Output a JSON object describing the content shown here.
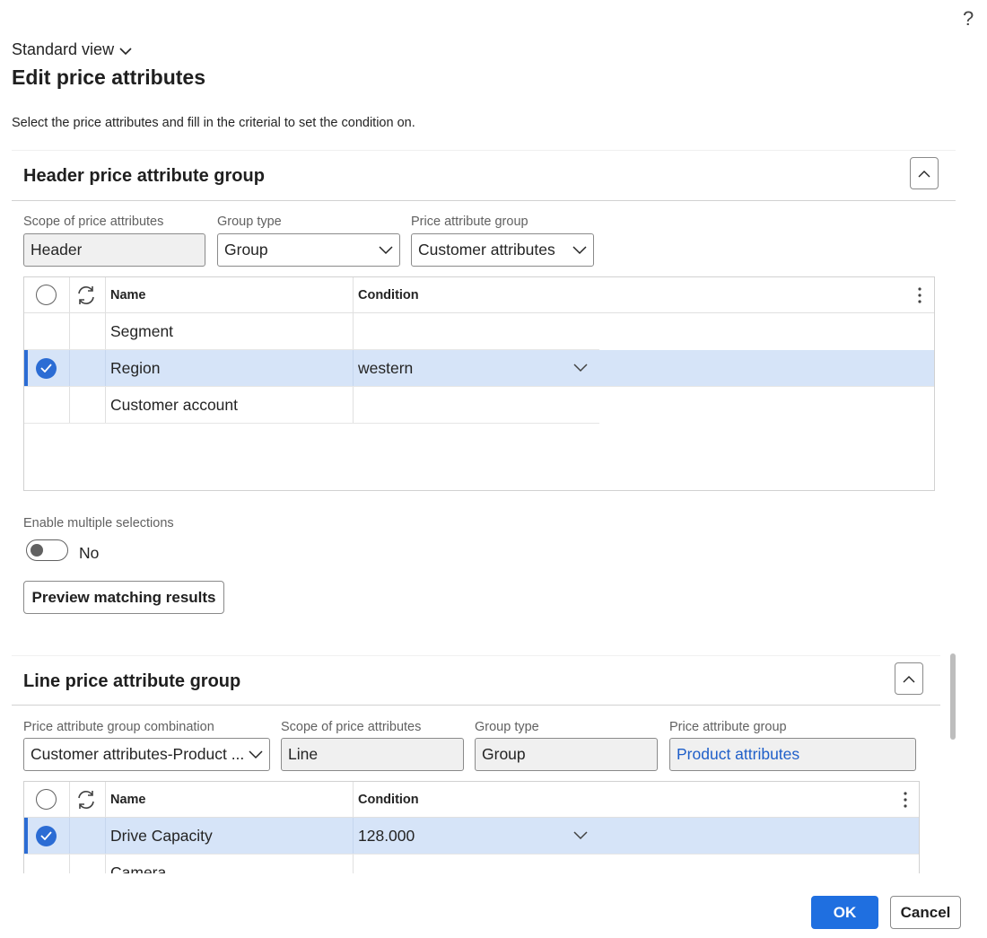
{
  "help": {
    "icon": "question-mark-icon",
    "label": "?"
  },
  "view_selector": {
    "label": "Standard view"
  },
  "page": {
    "title": "Edit price attributes",
    "description": "Select the price attributes and fill in the criterial to set the condition on."
  },
  "header_section": {
    "title": "Header price attribute group",
    "fields": {
      "scope": {
        "label": "Scope of price attributes",
        "value": "Header"
      },
      "group_type": {
        "label": "Group type",
        "value": "Group"
      },
      "price_group": {
        "label": "Price attribute group",
        "value": "Customer attributes"
      }
    },
    "grid": {
      "col_name": "Name",
      "col_condition": "Condition",
      "rows": [
        {
          "name": "Segment",
          "condition": "",
          "selected": false
        },
        {
          "name": "Region",
          "condition": "western",
          "selected": true
        },
        {
          "name": "Customer account",
          "condition": "",
          "selected": false
        }
      ]
    },
    "multi_select": {
      "label": "Enable multiple selections",
      "value": "No"
    },
    "preview_button": "Preview matching results"
  },
  "line_section": {
    "title": "Line price attribute group",
    "fields": {
      "combination": {
        "label": "Price attribute group combination",
        "value": "Customer attributes-Product ..."
      },
      "scope": {
        "label": "Scope of price attributes",
        "value": "Line"
      },
      "group_type": {
        "label": "Group type",
        "value": "Group"
      },
      "price_group": {
        "label": "Price attribute group",
        "value": "Product attributes"
      }
    },
    "grid": {
      "col_name": "Name",
      "col_condition": "Condition",
      "rows": [
        {
          "name": "Drive Capacity",
          "condition": "128.000",
          "selected": true
        },
        {
          "name": "Camera",
          "condition": "",
          "selected": false
        }
      ]
    }
  },
  "footer": {
    "ok": "OK",
    "cancel": "Cancel"
  },
  "colors": {
    "accent": "#1f6fe0",
    "selected_row": "#d6e4f8",
    "link": "#1f5fc9"
  }
}
